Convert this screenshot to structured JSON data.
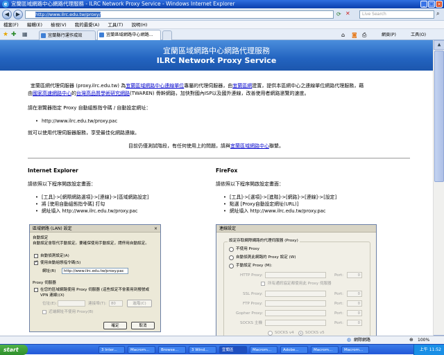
{
  "window": {
    "title": "宜蘭區域網路中心網路代理服務 - ILRC Network Proxy Service - Windows Internet Explorer",
    "ie_logo": "e",
    "minimize": "_",
    "maximize": "□",
    "close": "×"
  },
  "address_bar": {
    "url": "http://www.ilrc.edu.tw/proxy/",
    "search_placeholder": "Live Search"
  },
  "menu": [
    "檔案(F)",
    "編輯(E)",
    "檢視(V)",
    "我的最愛(A)",
    "工具(T)",
    "說明(H)"
  ],
  "tabs": [
    {
      "label": "宜蘭縣行運作成效"
    },
    {
      "label": "宜蘭區域網路中心網路..."
    }
  ],
  "toolbar": {
    "page": "網頁(P)",
    "tools": "工具(O)"
  },
  "banner": {
    "title_zh": "宜蘭區域網路中心網路代理服務",
    "title_en": "ILRC Network Proxy Service"
  },
  "intro": {
    "line1_pre": "宜蘭區網代理伺服器 (proxy.ilrc.edu.tw) 為",
    "line1_link1": "宜蘭區域網路中心連線單位",
    "line1_mid": "專屬的代理伺服器，由",
    "line1_link2": "宜蘭區網",
    "line1_post": "建置，提供本區網中心之連線單位網路代理服務，藉",
    "line2_pre": "由",
    "line2_link1": "國家高速網路中心",
    "line2_mid1": "的",
    "line2_link2": "台灣高品質學術研究網路",
    "line2_post": "(TWAREN) 骨幹網路，加快對國內ISP以及國外連線，改善使用者網路瀏覽的速度。"
  },
  "setup_text": "請在瀏覽器指定 Proxy 自動組態指令碼 / 自動設定網址：",
  "pac_url": "http://www.ilrc.edu.tw/proxy.pac",
  "enjoy_text": "就可以使用代理伺服器服務，享受最佳化網路連線。",
  "testing": {
    "pre": "目前仍僅測試階段，有任何使用上的問題，請與",
    "link": "宜蘭區域網路中心",
    "post": "聯繫。"
  },
  "ie_section": {
    "heading": "Internet Explorer",
    "instruction": "請依照以下程序開啟設定畫面：",
    "steps": [
      "[工具]->[網際網路選項]->[連線]->[區域網路設定]",
      "將 [使用自動組態指令碼] 打勾",
      "網址填入 http://www.ilrc.edu.tw/proxy.pac"
    ]
  },
  "ff_section": {
    "heading": "FireFox",
    "instruction": "請依照以下程序開啟設定畫面：",
    "steps": [
      "[工具]->[選項]->[進階]->[網路]->[連線]->[設定]",
      "點選 [Proxy自動設定網址(URL)]",
      "網址填入 http://www.ilrc.edu.tw/proxy.pac"
    ]
  },
  "ie_dialog": {
    "title": "區域網路 (LAN) 設定",
    "close": "×",
    "auto_group": "自動設定",
    "auto_desc": "自動設定會取代手動設定。要確保使用手動設定，請停用自動設定。",
    "auto_detect": "自動偵測設定(A)",
    "use_script": "使用自動組態指令碼(S)",
    "address_label": "網址(R)",
    "address_value": "http://www.ilrc.edu.tw/proxy.pac",
    "proxy_group": "Proxy 伺服器",
    "proxy_desc": "在您的區域網路使用 Proxy 伺服器 (這些設定不會套用到撥號或 VPN 連線)(X)",
    "addr_small": "位址(E):",
    "port_small": "連接埠(T):",
    "port_value": "80",
    "advanced": "進階(C)",
    "bypass": "近端網址不使用 Proxy(B)",
    "ok": "確定",
    "cancel": "取消"
  },
  "ff_dialog": {
    "title": "連線設定",
    "group": "設定存取網際網路的代理伺服器 (Proxy)",
    "no_proxy": "不使用 Proxy",
    "auto_detect": "自動偵測此網路的 Proxy 設定 (W)",
    "manual": "手動設定 Proxy (M):",
    "http": "HTTP Proxy:",
    "same_all": "所有通訊協定都使用此 Proxy 伺服器",
    "ssl": "SSL Proxy:",
    "ftp": "FTP Proxy:",
    "gopher": "Gopher Proxy:",
    "socks": "SOCKS 主機",
    "port": "Port:",
    "port_value": "0",
    "socks4": "SOCKS v4",
    "socks5": "SOCKS v5"
  },
  "status": {
    "zone": "網際網路",
    "zoom": "100%"
  },
  "taskbar": {
    "start": "start",
    "tasks": [
      "3 Inter...",
      "Macrom...",
      "Browse...",
      "3 Wind...",
      "宜蘭區",
      "Macrom...",
      "Adobe...",
      "Macrom...",
      "Macrom..."
    ],
    "clock": "上午 11:52"
  }
}
